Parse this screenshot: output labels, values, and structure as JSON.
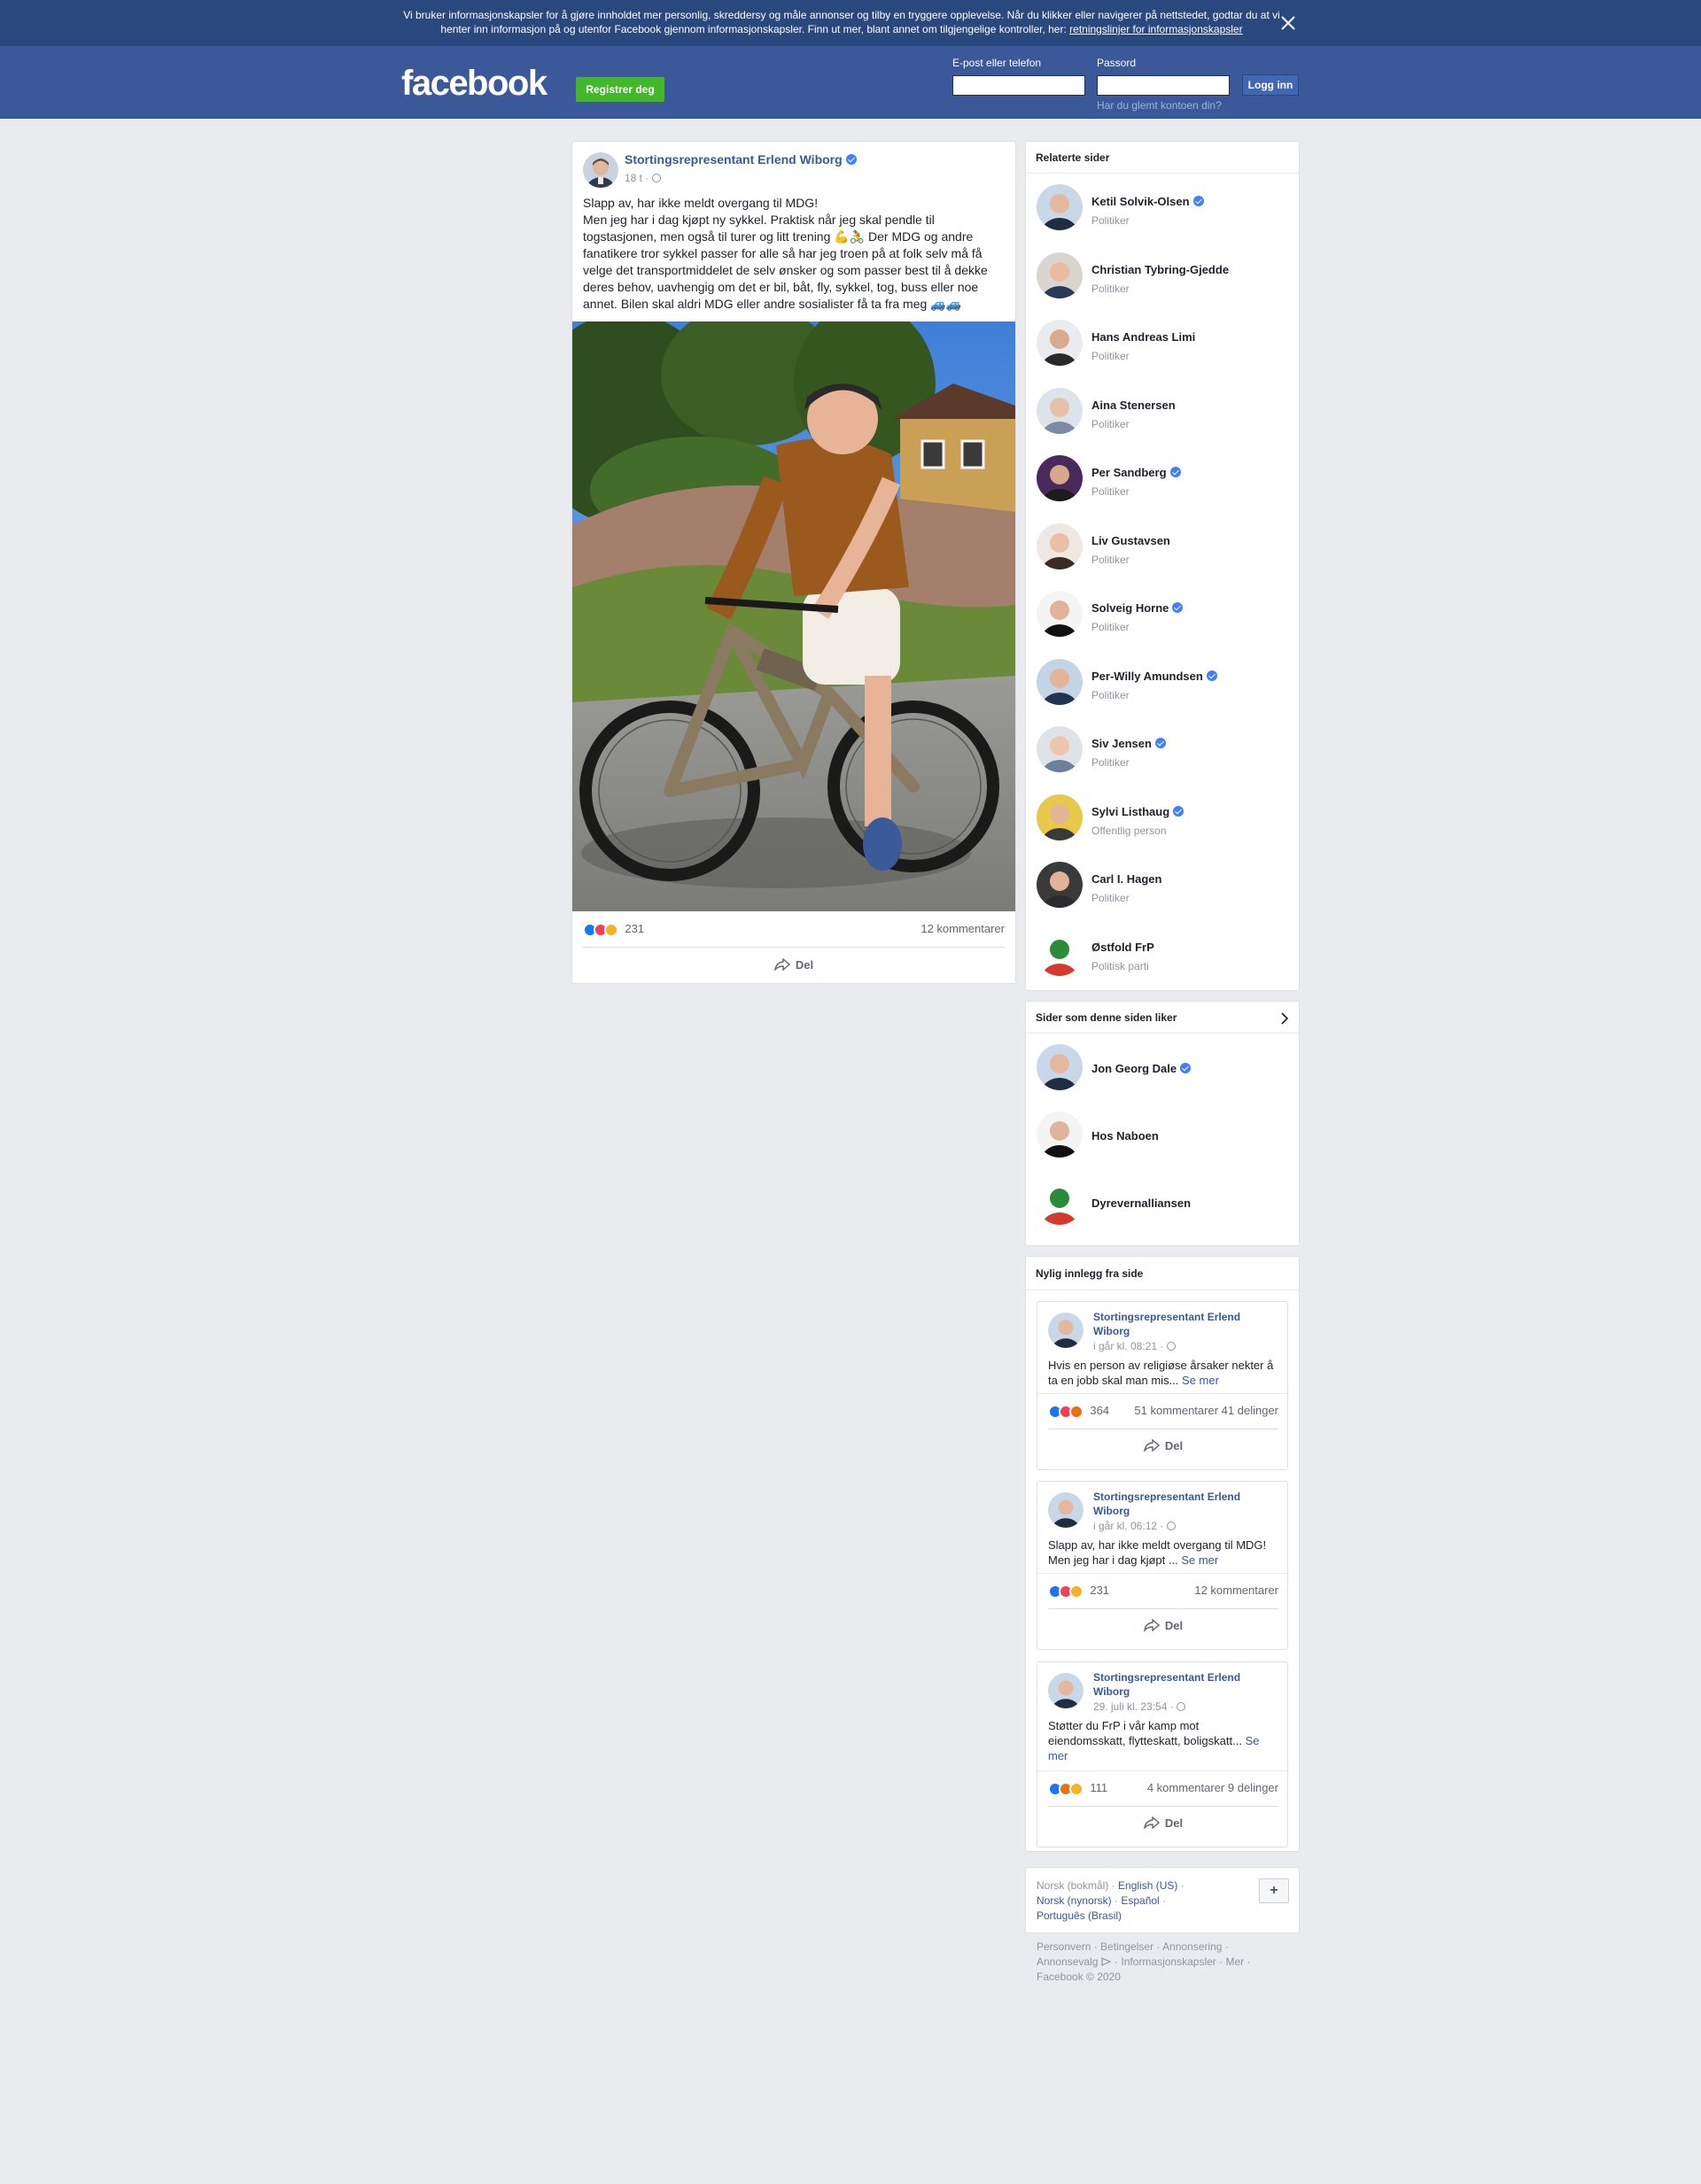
{
  "cookie_banner": {
    "text": "Vi bruker informasjonskapsler for å gjøre innholdet mer personlig, skreddersy og måle annonser og tilby en tryggere opplevelse. Når du klikker eller navigerer på nettstedet, godtar du at vi henter inn informasjon på og utenfor Facebook gjennom informasjonskapsler. Finn ut mer, blant annet om tilgjengelige kontroller, her:",
    "link": "retningslinjer for informasjonskapsler"
  },
  "header": {
    "logo": "facebook",
    "register_label": "Registrer deg",
    "email_label": "E-post eller telefon",
    "password_label": "Passord",
    "login_label": "Logg inn",
    "forgot_label": "Har du glemt kontoen din?"
  },
  "post": {
    "author": "Stortingsrepresentant Erlend Wiborg",
    "time": "18 t ·",
    "text": "Slapp av, har ikke meldt overgang til MDG!\nMen jeg har i dag kjøpt ny sykkel. Praktisk når jeg skal pendle til togstasjonen, men også til turer og litt trening 💪🚴 Der MDG og andre fanatikere tror sykkel passer for alle så har jeg troen på at folk selv må få velge det transportmiddelet de selv ønsker og som passer best til å dekke deres behov, uavhengig om det er bil, båt, fly, sykkel, tog, buss eller noe annet. Bilen skal aldri MDG eller andre sosialister få ta fra meg 🚙🚙",
    "reactions": "231",
    "comments": "12 kommentarer",
    "share_label": "Del"
  },
  "related": {
    "title": "Relaterte sider",
    "items": [
      {
        "name": "Ketil Solvik-Olsen",
        "role": "Politiker",
        "verified": true
      },
      {
        "name": "Christian Tybring-Gjedde",
        "role": "Politiker",
        "verified": false
      },
      {
        "name": "Hans Andreas Limi",
        "role": "Politiker",
        "verified": false
      },
      {
        "name": "Aina Stenersen",
        "role": "Politiker",
        "verified": false
      },
      {
        "name": "Per Sandberg",
        "role": "Politiker",
        "verified": true
      },
      {
        "name": "Liv Gustavsen",
        "role": "Politiker",
        "verified": false
      },
      {
        "name": "Solveig Horne",
        "role": "Politiker",
        "verified": true
      },
      {
        "name": "Per-Willy Amundsen",
        "role": "Politiker",
        "verified": true
      },
      {
        "name": "Siv Jensen",
        "role": "Politiker",
        "verified": true
      },
      {
        "name": "Sylvi Listhaug",
        "role": "Offentlig person",
        "verified": true
      },
      {
        "name": "Carl I. Hagen",
        "role": "Politiker",
        "verified": false
      },
      {
        "name": "Østfold FrP",
        "role": "Politisk parti",
        "verified": false
      }
    ]
  },
  "liked": {
    "title": "Sider som denne siden liker",
    "items": [
      {
        "name": "Jon Georg Dale",
        "verified": true
      },
      {
        "name": "Hos Naboen",
        "verified": false
      },
      {
        "name": "Dyrevernalliansen",
        "verified": false
      }
    ]
  },
  "recent": {
    "title": "Nylig innlegg fra side",
    "posts": [
      {
        "author": "Stortingsrepresentant Erlend Wiborg",
        "time": "i går kl. 08:21 ·",
        "text": "Hvis en person av religiøse årsaker nekter å ta en jobb skal man mis...",
        "see_more": "Se mer",
        "reactions": "364",
        "comments": "51 kommentarer",
        "shares": "41 delinger",
        "share_label": "Del"
      },
      {
        "author": "Stortingsrepresentant Erlend Wiborg",
        "time": "i går kl. 06:12 ·",
        "text": "Slapp av, har ikke meldt overgang til MDG! Men jeg har i dag kjøpt ...",
        "see_more": "Se mer",
        "reactions": "231",
        "comments": "12 kommentarer",
        "shares": "",
        "share_label": "Del"
      },
      {
        "author": "Stortingsrepresentant Erlend Wiborg",
        "time": "29. juli kl. 23:54 ·",
        "text": "Støtter du FrP i vår kamp mot eiendomsskatt, flytteskatt, boligskatt...",
        "see_more": "Se mer",
        "reactions": "111",
        "comments": "4 kommentarer",
        "shares": "9 delinger",
        "share_label": "Del"
      }
    ]
  },
  "languages": {
    "current": "Norsk (bokmål) ·",
    "english": "English (US)",
    "nynorsk": "Norsk (nynorsk)",
    "spanish": "Español",
    "portuguese": "Português (Brasil)",
    "add_label": "+"
  },
  "footer": {
    "links": "Personvern · Betingelser · Annonsering · Annonsevalg",
    "links2": "· Informasjonskapsler · Mer ·",
    "copyright": "Facebook © 2020"
  },
  "colors": {
    "brand": "#3b5998",
    "banner": "#29487d",
    "register": "#42b72a",
    "link": "#385898"
  }
}
